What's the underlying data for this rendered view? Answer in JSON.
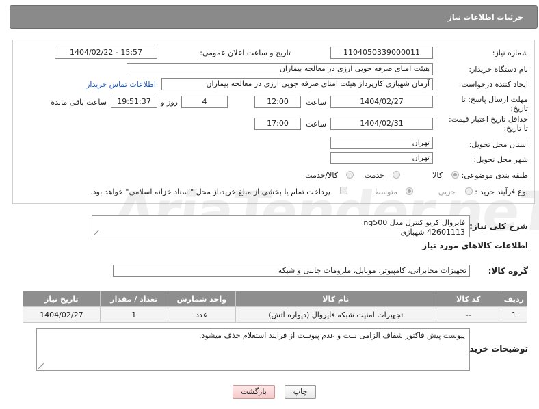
{
  "header": {
    "title": "جزئیات اطلاعات نیاز"
  },
  "form": {
    "need_number": {
      "label": "شماره نیاز:",
      "value": "1104050339000011"
    },
    "announce_datetime": {
      "label": "تاریخ و ساعت اعلان عمومی:",
      "value": "1404/02/22 - 15:57"
    },
    "buyer_org": {
      "label": "نام دستگاه خریدار:",
      "value": "هیئت امنای صرفه جویی ارزی در معالجه بیماران"
    },
    "requester": {
      "label": "ایجاد کننده درخواست:",
      "value": "آرمان شهبازی کارپرداز هیئت امنای صرفه جویی ارزی در معالجه بیماران",
      "link": "اطلاعات تماس خریدار"
    },
    "response_deadline": {
      "label_line1": "مهلت ارسال پاسخ: تا",
      "label_line2": "تاریخ:",
      "date": "1404/02/27",
      "time_label": "ساعت",
      "time": "12:00",
      "days": "4",
      "days_label": "روز و",
      "remaining": "19:51:37",
      "remaining_label": "ساعت باقی مانده"
    },
    "price_validity": {
      "label_line1": "حداقل تاریخ اعتبار قیمت:",
      "label_line2": "تا تاریخ:",
      "date": "1404/02/31",
      "time_label": "ساعت",
      "time": "17:00"
    },
    "delivery_province": {
      "label": "استان محل تحویل:",
      "value": "تهران"
    },
    "delivery_city": {
      "label": "شهر محل تحویل:",
      "value": "تهران"
    },
    "category": {
      "label": "طبقه بندی موضوعی:",
      "options": [
        "کالا",
        "خدمت",
        "کالا/خدمت"
      ],
      "selected": "کالا"
    },
    "purchase_type": {
      "label": "نوع فرآیند خرید :",
      "options": [
        "جزیی",
        "متوسط"
      ],
      "selected": "متوسط",
      "note": "پرداخت تمام یا بخشی از مبلغ خرید،از محل \"اسناد خزانه اسلامی\" خواهد بود."
    }
  },
  "watermark": "AriaTender.neT",
  "description": {
    "label": "شرح کلی نیاز:",
    "line1": "فایروال کریو کنترل مدل ng500",
    "line2": "42601113 شهبازی"
  },
  "goods_info": {
    "title": "اطلاعات کالاهای مورد نیاز"
  },
  "goods_group": {
    "label": "گروه کالا:",
    "value": "تجهیزات مخابراتی، کامپیوتر، موبایل، ملزومات جانبی و شبکه"
  },
  "table": {
    "headers": [
      "ردیف",
      "کد کالا",
      "نام کالا",
      "واحد شمارش",
      "تعداد / مقدار",
      "تاریخ نیاز"
    ],
    "rows": [
      [
        "1",
        "--",
        "تجهیزات امنیت شبکه فایروال (دیواره آتش)",
        "عدد",
        "1",
        "1404/02/27"
      ]
    ]
  },
  "buyer_notes": {
    "label": "توضیحات خریدار:",
    "value": "پیوست پیش فاکتور شفاف الزامی ست و عدم پیوست از فرایند استعلام حذف میشود."
  },
  "buttons": {
    "print": "چاپ",
    "back": "بازگشت"
  }
}
